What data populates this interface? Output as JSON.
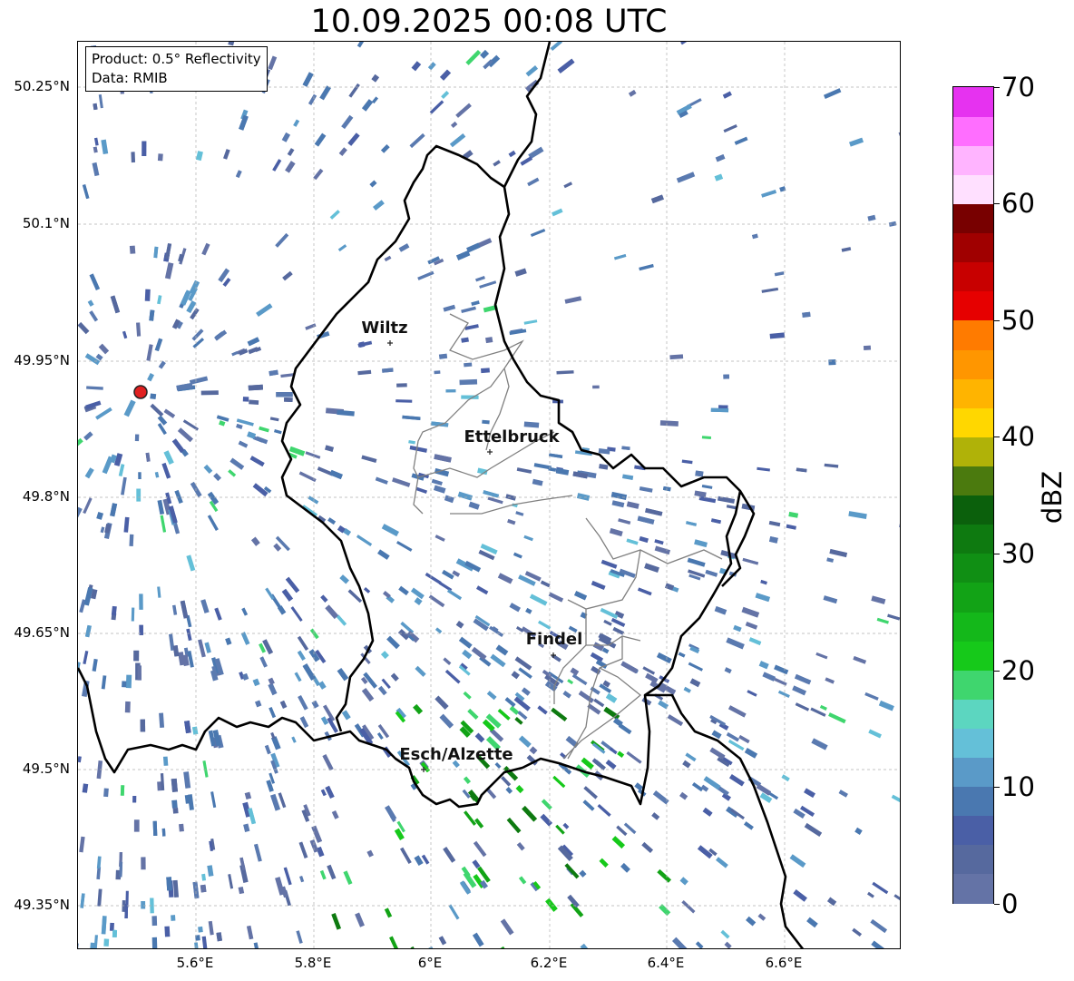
{
  "title": "10.09.2025 00:08 UTC",
  "info_box": {
    "product": "Product: 0.5° Reflectivity",
    "data": "Data: RMIB"
  },
  "lat_labels": [
    "50.25°N",
    "50.1°N",
    "49.95°N",
    "49.8°N",
    "49.65°N",
    "49.5°N",
    "49.35°N"
  ],
  "lon_labels": [
    "5.6°E",
    "5.8°E",
    "6°E",
    "6.2°E",
    "6.4°E",
    "6.6°E"
  ],
  "colorbar": {
    "label": "dBZ",
    "min": 0,
    "max": 70,
    "step": 2.5,
    "ticks": [
      "0",
      "10",
      "20",
      "30",
      "40",
      "50",
      "60",
      "70"
    ],
    "colors": [
      "#6473a6",
      "#56699e",
      "#4a5fa6",
      "#4a78b0",
      "#5a9ac8",
      "#64c0d8",
      "#5cd6c0",
      "#3fd66e",
      "#16c91a",
      "#14b81a",
      "#12a316",
      "#108f14",
      "#0e7a10",
      "#0b600c",
      "#4b7a0e",
      "#b0b208",
      "#ffd700",
      "#ffb400",
      "#ff9600",
      "#ff7b00",
      "#e60000",
      "#c80000",
      "#a00000",
      "#780000",
      "#ffe0ff",
      "#ffb4ff",
      "#ff6eff",
      "#e632f0"
    ]
  },
  "cities": [
    {
      "name": "Wiltz"
    },
    {
      "name": "Ettelbruck"
    },
    {
      "name": "Findel"
    },
    {
      "name": "Esch/Alzette"
    }
  ],
  "radar_site": {
    "color": "#e02020"
  }
}
